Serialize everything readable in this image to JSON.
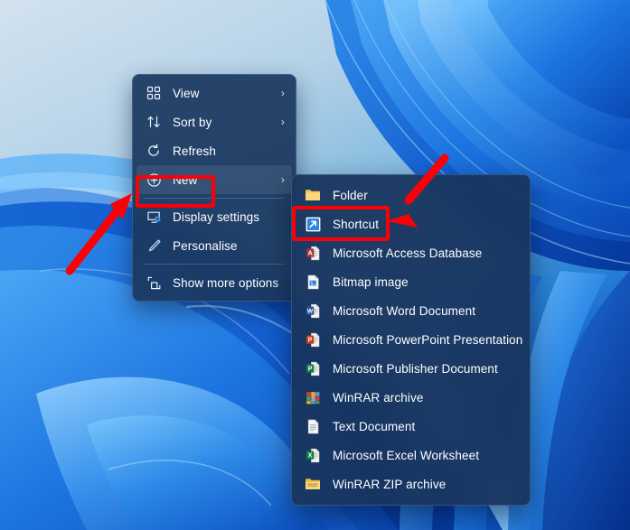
{
  "desktop": {
    "wallpaper_name": "windows-11-bloom-wallpaper",
    "background_colors": [
      "#cfe0ee",
      "#8fbfe0",
      "#1b74d4",
      "#0c55c0"
    ]
  },
  "context_menu": {
    "name": "desktop-context-menu",
    "background_color": "#1b385f",
    "items": [
      {
        "label": "View",
        "icon": "grid-view-icon",
        "has_submenu": true,
        "highlighted": false
      },
      {
        "label": "Sort by",
        "icon": "sort-arrows-icon",
        "has_submenu": true,
        "highlighted": false
      },
      {
        "label": "Refresh",
        "icon": "refresh-icon",
        "has_submenu": false,
        "highlighted": false
      },
      {
        "label": "New",
        "icon": "plus-circle-icon",
        "has_submenu": true,
        "highlighted": true
      },
      {
        "label": "Display settings",
        "icon": "monitor-settings-icon",
        "has_submenu": false,
        "highlighted": false
      },
      {
        "label": "Personalise",
        "icon": "paintbrush-icon",
        "has_submenu": false,
        "highlighted": false
      },
      {
        "label": "Show more options",
        "icon": "expand-options-icon",
        "has_submenu": false,
        "highlighted": false
      }
    ],
    "separator_after_indexes": [
      3,
      5
    ],
    "chevron_glyph": "›"
  },
  "new_submenu": {
    "name": "new-submenu",
    "background_color": "#18345c",
    "items": [
      {
        "label": "Folder",
        "icon": "folder-icon"
      },
      {
        "label": "Shortcut",
        "icon": "shortcut-arrow-icon"
      },
      {
        "label": "Microsoft Access Database",
        "icon": "access-database-icon"
      },
      {
        "label": "Bitmap image",
        "icon": "bitmap-image-icon"
      },
      {
        "label": "Microsoft Word Document",
        "icon": "word-document-icon"
      },
      {
        "label": "Microsoft PowerPoint Presentation",
        "icon": "powerpoint-presentation-icon"
      },
      {
        "label": "Microsoft Publisher Document",
        "icon": "publisher-document-icon"
      },
      {
        "label": "WinRAR archive",
        "icon": "winrar-archive-icon"
      },
      {
        "label": "Text Document",
        "icon": "text-document-icon"
      },
      {
        "label": "Microsoft Excel Worksheet",
        "icon": "excel-worksheet-icon"
      },
      {
        "label": "WinRAR ZIP archive",
        "icon": "winrar-zip-archive-icon"
      }
    ]
  },
  "annotations": {
    "highlight_color": "#fb0007",
    "boxes": [
      {
        "name": "new-highlight-box",
        "target": "New"
      },
      {
        "name": "shortcut-highlight-box",
        "target": "Shortcut"
      }
    ],
    "arrows": [
      {
        "name": "arrow-pointing-to-new",
        "direction": "up-right"
      },
      {
        "name": "arrow-pointing-to-shortcut",
        "direction": "down-left"
      }
    ]
  }
}
